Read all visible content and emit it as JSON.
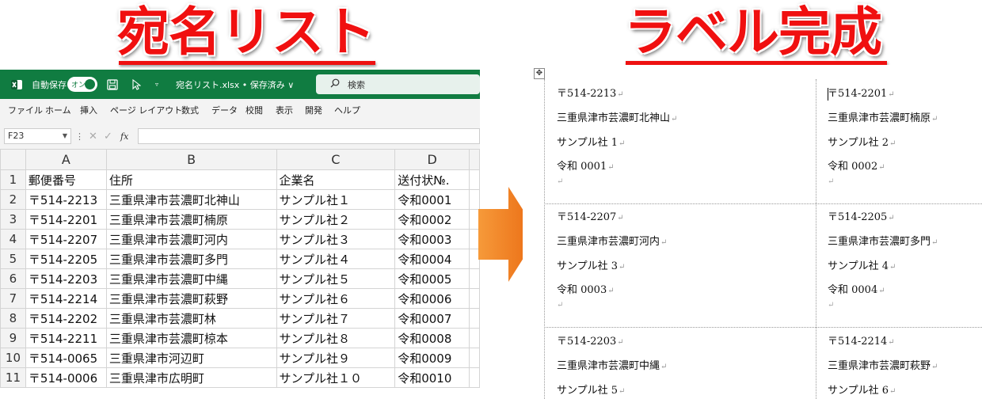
{
  "titles": {
    "left": "宛名リスト",
    "right": "ラベル完成"
  },
  "excel": {
    "autosave_label": "自動保存",
    "autosave_state": "オン",
    "file_name": "宛名リスト.xlsx • 保存済み ∨",
    "search_placeholder": "検索",
    "ribbon_tabs": [
      "ファイル",
      "ホーム",
      "挿入",
      "ページ レイアウト",
      "数式",
      "データ",
      "校閲",
      "表示",
      "開発",
      "ヘルプ"
    ],
    "name_box": "F23",
    "fx_label": "fx",
    "columns": [
      "A",
      "B",
      "C",
      "D"
    ],
    "rows": [
      {
        "num": "1",
        "cells": [
          "郵便番号",
          "住所",
          "企業名",
          "送付状№."
        ]
      },
      {
        "num": "2",
        "cells": [
          "〒514-2213",
          "三重県津市芸濃町北神山",
          "サンプル社１",
          "令和0001"
        ]
      },
      {
        "num": "3",
        "cells": [
          "〒514-2201",
          "三重県津市芸濃町楠原",
          "サンプル社２",
          "令和0002"
        ]
      },
      {
        "num": "4",
        "cells": [
          "〒514-2207",
          "三重県津市芸濃町河内",
          "サンプル社３",
          "令和0003"
        ]
      },
      {
        "num": "5",
        "cells": [
          "〒514-2205",
          "三重県津市芸濃町多門",
          "サンプル社４",
          "令和0004"
        ]
      },
      {
        "num": "6",
        "cells": [
          "〒514-2203",
          "三重県津市芸濃町中縄",
          "サンプル社５",
          "令和0005"
        ]
      },
      {
        "num": "7",
        "cells": [
          "〒514-2214",
          "三重県津市芸濃町萩野",
          "サンプル社６",
          "令和0006"
        ]
      },
      {
        "num": "8",
        "cells": [
          "〒514-2202",
          "三重県津市芸濃町林",
          "サンプル社７",
          "令和0007"
        ]
      },
      {
        "num": "9",
        "cells": [
          "〒514-2211",
          "三重県津市芸濃町椋本",
          "サンプル社８",
          "令和0008"
        ]
      },
      {
        "num": "10",
        "cells": [
          "〒514-0065",
          "三重県津市河辺町",
          "サンプル社９",
          "令和0009"
        ]
      },
      {
        "num": "11",
        "cells": [
          "〒514-0006",
          "三重県津市広明町",
          "サンプル社１０",
          "令和0010"
        ]
      }
    ]
  },
  "labels": [
    {
      "zip": "〒514-2213",
      "address": "三重県津市芸濃町北神山",
      "company": "サンプル社 1",
      "number": "令和 0001"
    },
    {
      "zip": "〒514-2201",
      "address": "三重県津市芸濃町楠原",
      "company": "サンプル社 2",
      "number": "令和 0002"
    },
    {
      "zip": "〒514-2207",
      "address": "三重県津市芸濃町河内",
      "company": "サンプル社 3",
      "number": "令和 0003"
    },
    {
      "zip": "〒514-2205",
      "address": "三重県津市芸濃町多門",
      "company": "サンプル社 4",
      "number": "令和 0004"
    },
    {
      "zip": "〒514-2203",
      "address": "三重県津市芸濃町中縄",
      "company": "サンプル社 5",
      "number": ""
    },
    {
      "zip": "〒514-2214",
      "address": "三重県津市芸濃町萩野",
      "company": "サンプル社 6",
      "number": ""
    }
  ],
  "colors": {
    "title_red": "#f01010",
    "excel_green": "#107c41",
    "arrow_orange": "#f07a1a"
  },
  "icons": [
    "excel-logo-icon",
    "save-icon",
    "cursor-icon",
    "search-icon",
    "move-handle-icon",
    "arrow-right-icon"
  ]
}
